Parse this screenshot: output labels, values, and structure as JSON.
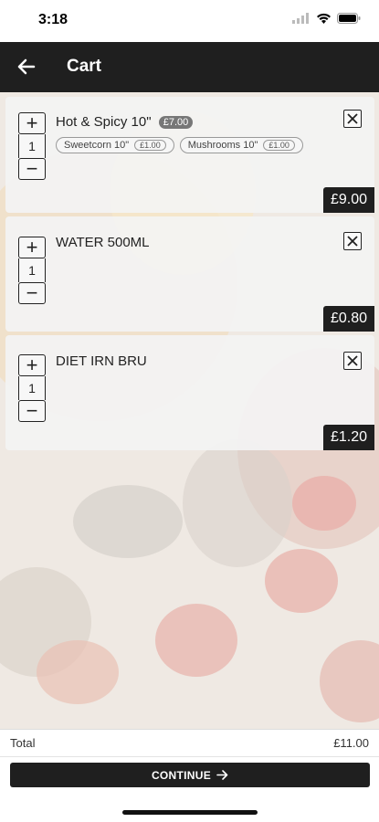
{
  "status_bar": {
    "time": "3:18"
  },
  "header": {
    "title": "Cart"
  },
  "cart": {
    "items": [
      {
        "name": "Hot & Spicy 10\"",
        "base_price": "£7.00",
        "quantity": "1",
        "options": [
          {
            "name": "Sweetcorn 10\"",
            "price": "£1.00"
          },
          {
            "name": "Mushrooms 10\"",
            "price": "£1.00"
          }
        ],
        "total": "£9.00"
      },
      {
        "name": "WATER 500ML",
        "quantity": "1",
        "total": "£0.80"
      },
      {
        "name": "DIET IRN BRU",
        "quantity": "1",
        "total": "£1.20"
      }
    ]
  },
  "footer": {
    "total_label": "Total",
    "total_value": "£11.00",
    "continue_label": "CONTINUE"
  },
  "icons": {
    "back": "arrow-left-icon",
    "remove": "close-icon",
    "continue": "arrow-right-icon"
  }
}
